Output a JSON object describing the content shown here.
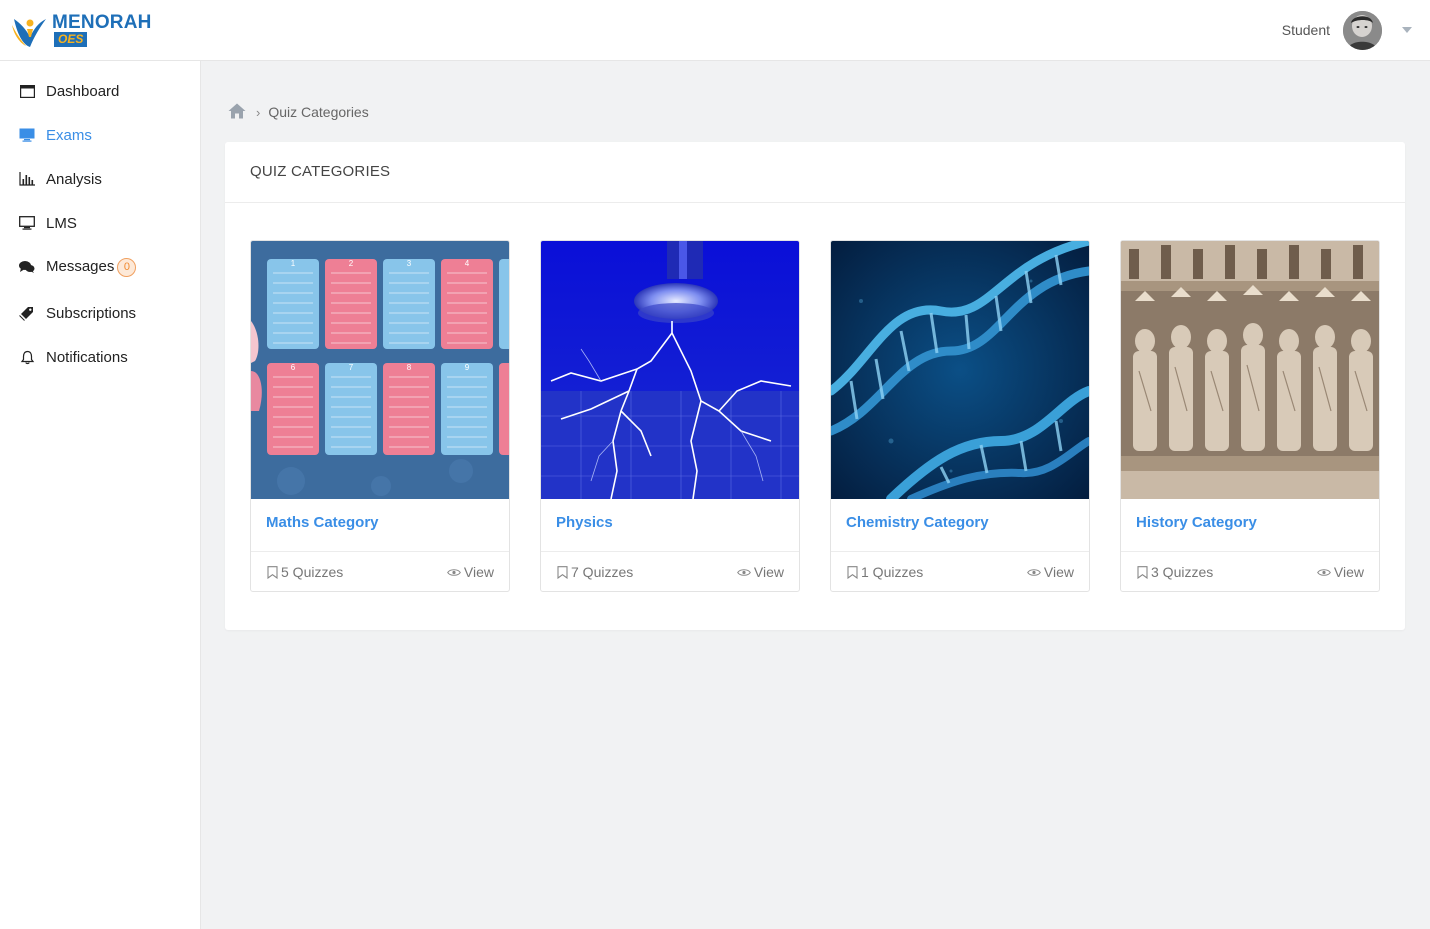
{
  "brand": {
    "name": "MENORAH",
    "sub": "OES"
  },
  "header": {
    "user_label": "Student"
  },
  "sidebar": {
    "items": [
      {
        "label": "Dashboard",
        "icon": "window-icon",
        "active": false
      },
      {
        "label": "Exams",
        "icon": "monitor-icon",
        "active": true
      },
      {
        "label": "Analysis",
        "icon": "bar-chart-icon",
        "active": false
      },
      {
        "label": "LMS",
        "icon": "monitor-icon",
        "active": false
      },
      {
        "label": "Messages",
        "icon": "chat-icon",
        "active": false,
        "badge": "0"
      },
      {
        "label": "Subscriptions",
        "icon": "tag-icon",
        "active": false
      },
      {
        "label": "Notifications",
        "icon": "bell-icon",
        "active": false
      }
    ]
  },
  "breadcrumb": {
    "current": "Quiz Categories"
  },
  "panel": {
    "title": "QUIZ CATEGORIES"
  },
  "categories": [
    {
      "title": "Maths Category",
      "count": "5 Quizzes",
      "view": "View",
      "image": "multiplication-tables-image"
    },
    {
      "title": "Physics",
      "count": "7 Quizzes",
      "view": "View",
      "image": "tesla-coil-lightning-image"
    },
    {
      "title": "Chemistry Category",
      "count": "1 Quizzes",
      "view": "View",
      "image": "dna-helix-image"
    },
    {
      "title": "History Category",
      "count": "3 Quizzes",
      "view": "View",
      "image": "cathedral-statues-image"
    }
  ],
  "colors": {
    "accent": "#3a8ee6",
    "brand": "#1e6fb8",
    "brand_secondary": "#f7b21f",
    "background": "#f1f2f3"
  }
}
